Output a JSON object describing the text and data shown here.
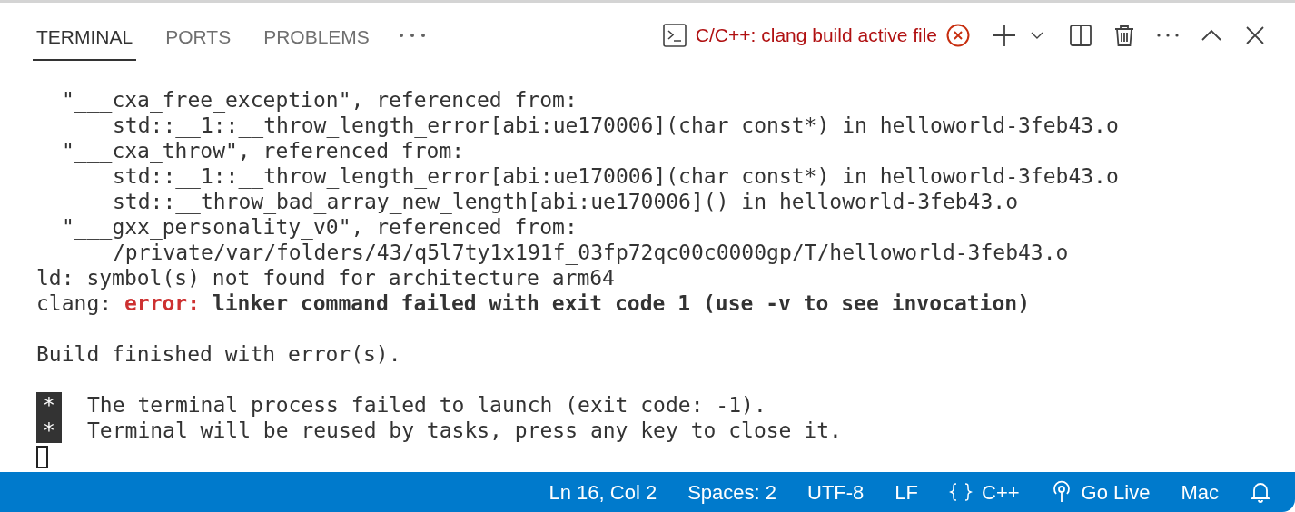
{
  "tabs": [
    {
      "label": "TERMINAL",
      "selected": true
    },
    {
      "label": "PORTS",
      "selected": false
    },
    {
      "label": "PROBLEMS",
      "selected": false
    }
  ],
  "task": {
    "label": "C/C++: clang build active file",
    "failed": true
  },
  "terminal": {
    "lines": [
      {
        "kind": "symbol",
        "text": "\"___cxa_free_exception\", referenced from:"
      },
      {
        "kind": "reference",
        "text": "std::__1::__throw_length_error[abi:ue170006](char const*) in helloworld-3feb43.o"
      },
      {
        "kind": "symbol",
        "text": "\"___cxa_throw\", referenced from:"
      },
      {
        "kind": "reference",
        "text": "std::__1::__throw_length_error[abi:ue170006](char const*) in helloworld-3feb43.o"
      },
      {
        "kind": "reference",
        "text": "std::__throw_bad_array_new_length[abi:ue170006]() in helloworld-3feb43.o"
      },
      {
        "kind": "symbol",
        "text": "\"___gxx_personality_v0\", referenced from:"
      },
      {
        "kind": "reference",
        "text": "/private/var/folders/43/q5l7ty1x191f_03fp72qc00c0000gp/T/helloworld-3feb43.o"
      },
      {
        "kind": "text",
        "text": "ld: symbol(s) not found for architecture arm64"
      },
      {
        "kind": "error",
        "prefix": "clang:",
        "label": "error:",
        "message": "linker command failed with exit code 1 (use -v to see invocation)"
      },
      {
        "kind": "blank"
      },
      {
        "kind": "text",
        "text": "Build finished with error(s)."
      },
      {
        "kind": "blank"
      },
      {
        "kind": "task",
        "marker": "*",
        "text": "The terminal process failed to launch (exit code: -1)."
      },
      {
        "kind": "task",
        "marker": "*",
        "text": "Terminal will be reused by tasks, press any key to close it."
      },
      {
        "kind": "cursor"
      }
    ]
  },
  "status_bar": {
    "items": [
      {
        "kind": "text",
        "label": "Ln 16, Col 2"
      },
      {
        "kind": "text",
        "label": "Spaces: 2"
      },
      {
        "kind": "text",
        "label": "UTF-8"
      },
      {
        "kind": "text",
        "label": "LF"
      },
      {
        "kind": "language",
        "label": "C++"
      },
      {
        "kind": "live",
        "label": "Go Live"
      },
      {
        "kind": "text",
        "label": "Mac"
      },
      {
        "kind": "bell"
      }
    ]
  }
}
